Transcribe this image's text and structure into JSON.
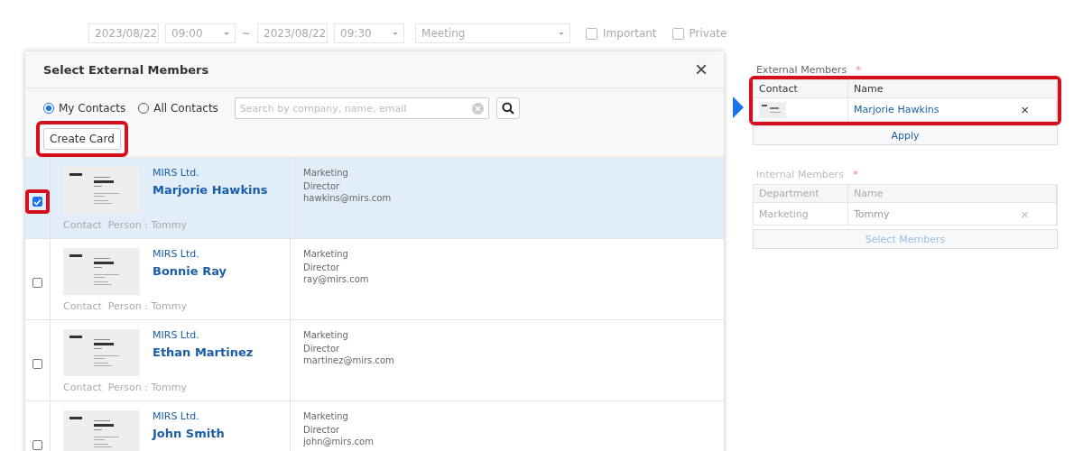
{
  "schedule": {
    "start_date": "2023/08/22",
    "start_time": "09:00",
    "separator": "~",
    "end_date": "2023/08/22",
    "end_time": "09:30",
    "type_placeholder": "Meeting",
    "flags": [
      {
        "label": "Important",
        "checked": false
      },
      {
        "label": "Private",
        "checked": false
      }
    ]
  },
  "dialog": {
    "title": "Select External Members",
    "close": "×",
    "scope": [
      {
        "label": "My Contacts",
        "selected": true
      },
      {
        "label": "All Contacts",
        "selected": false
      }
    ],
    "search": {
      "placeholder": "Search by company, name, email"
    },
    "create_card": {
      "label": "Create Card",
      "highlighted": true
    },
    "rows": [
      {
        "checked": true,
        "highlighted": true,
        "selected": true,
        "company": "MIRS Ltd.",
        "name": "Marjorie Hawkins",
        "contact": "Contact  Person : Tommy",
        "department": "Marketing",
        "title": "Director",
        "email": "hawkins@mirs.com"
      },
      {
        "checked": false,
        "highlighted": false,
        "selected": false,
        "company": "MIRS Ltd.",
        "name": "Bonnie Ray",
        "contact": "Contact  Person : Tommy",
        "department": "Marketing",
        "title": "Director",
        "email": "ray@mirs.com"
      },
      {
        "checked": false,
        "highlighted": false,
        "selected": false,
        "company": "MIRS Ltd.",
        "name": "Ethan Martinez",
        "contact": "Contact  Person : Tommy",
        "department": "Marketing",
        "title": "Director",
        "email": "martinez@mirs.com"
      },
      {
        "checked": false,
        "highlighted": false,
        "selected": false,
        "company": "MIRS Ltd.",
        "name": "John Smith",
        "department": "Marketing",
        "title": "Director",
        "email": "john@mirs.com"
      }
    ]
  },
  "external_members": {
    "label": "External Members",
    "required": "*",
    "highlighted": true,
    "columns": [
      "Contact",
      "Name"
    ],
    "rows": [
      {
        "name": "Marjorie Hawkins",
        "remove": "×"
      }
    ],
    "apply": "Apply"
  },
  "internal_members": {
    "label": "Internal Members",
    "required": "*",
    "columns": [
      "Department",
      "Name"
    ],
    "rows": [
      {
        "department": "Marketing",
        "name": "Tommy",
        "remove": "×"
      }
    ],
    "select": "Select Members"
  }
}
